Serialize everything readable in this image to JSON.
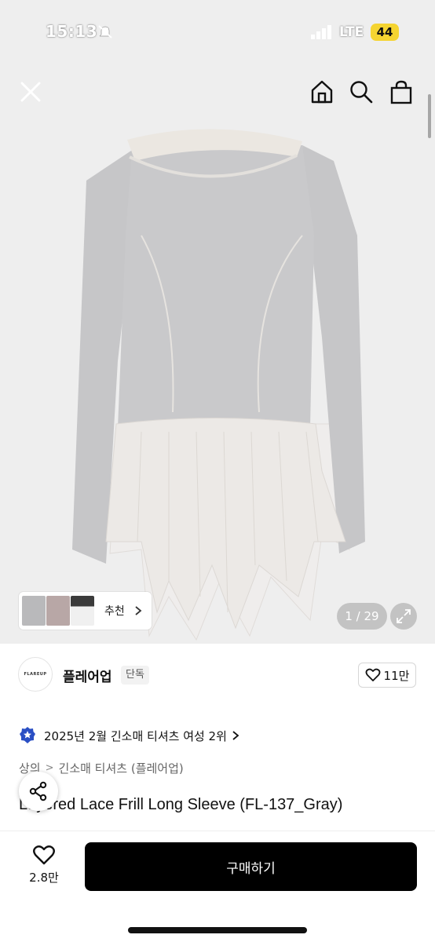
{
  "status_bar": {
    "time": "15:13",
    "network": "LTE",
    "battery": "44"
  },
  "gallery": {
    "counter": "1 / 29",
    "recommend_label": "추천"
  },
  "brand": {
    "logo_text": "FLAREUP",
    "name": "플레어업",
    "badge": "단독",
    "likes": "11만"
  },
  "ranking": {
    "text": "2025년 2월 긴소매 티셔츠 여성 2위"
  },
  "breadcrumb": {
    "items": [
      "상의",
      "긴소매 티셔츠 (플레어업)"
    ]
  },
  "product": {
    "title": "Layered Lace Frill Long Sleeve (FL-137_Gray)"
  },
  "bottom_bar": {
    "wish_count": "2.8만",
    "buy_label": "구매하기"
  },
  "colors": {
    "accent": "#000000",
    "battery": "#f5d431",
    "medal": "#2a4fc4"
  }
}
